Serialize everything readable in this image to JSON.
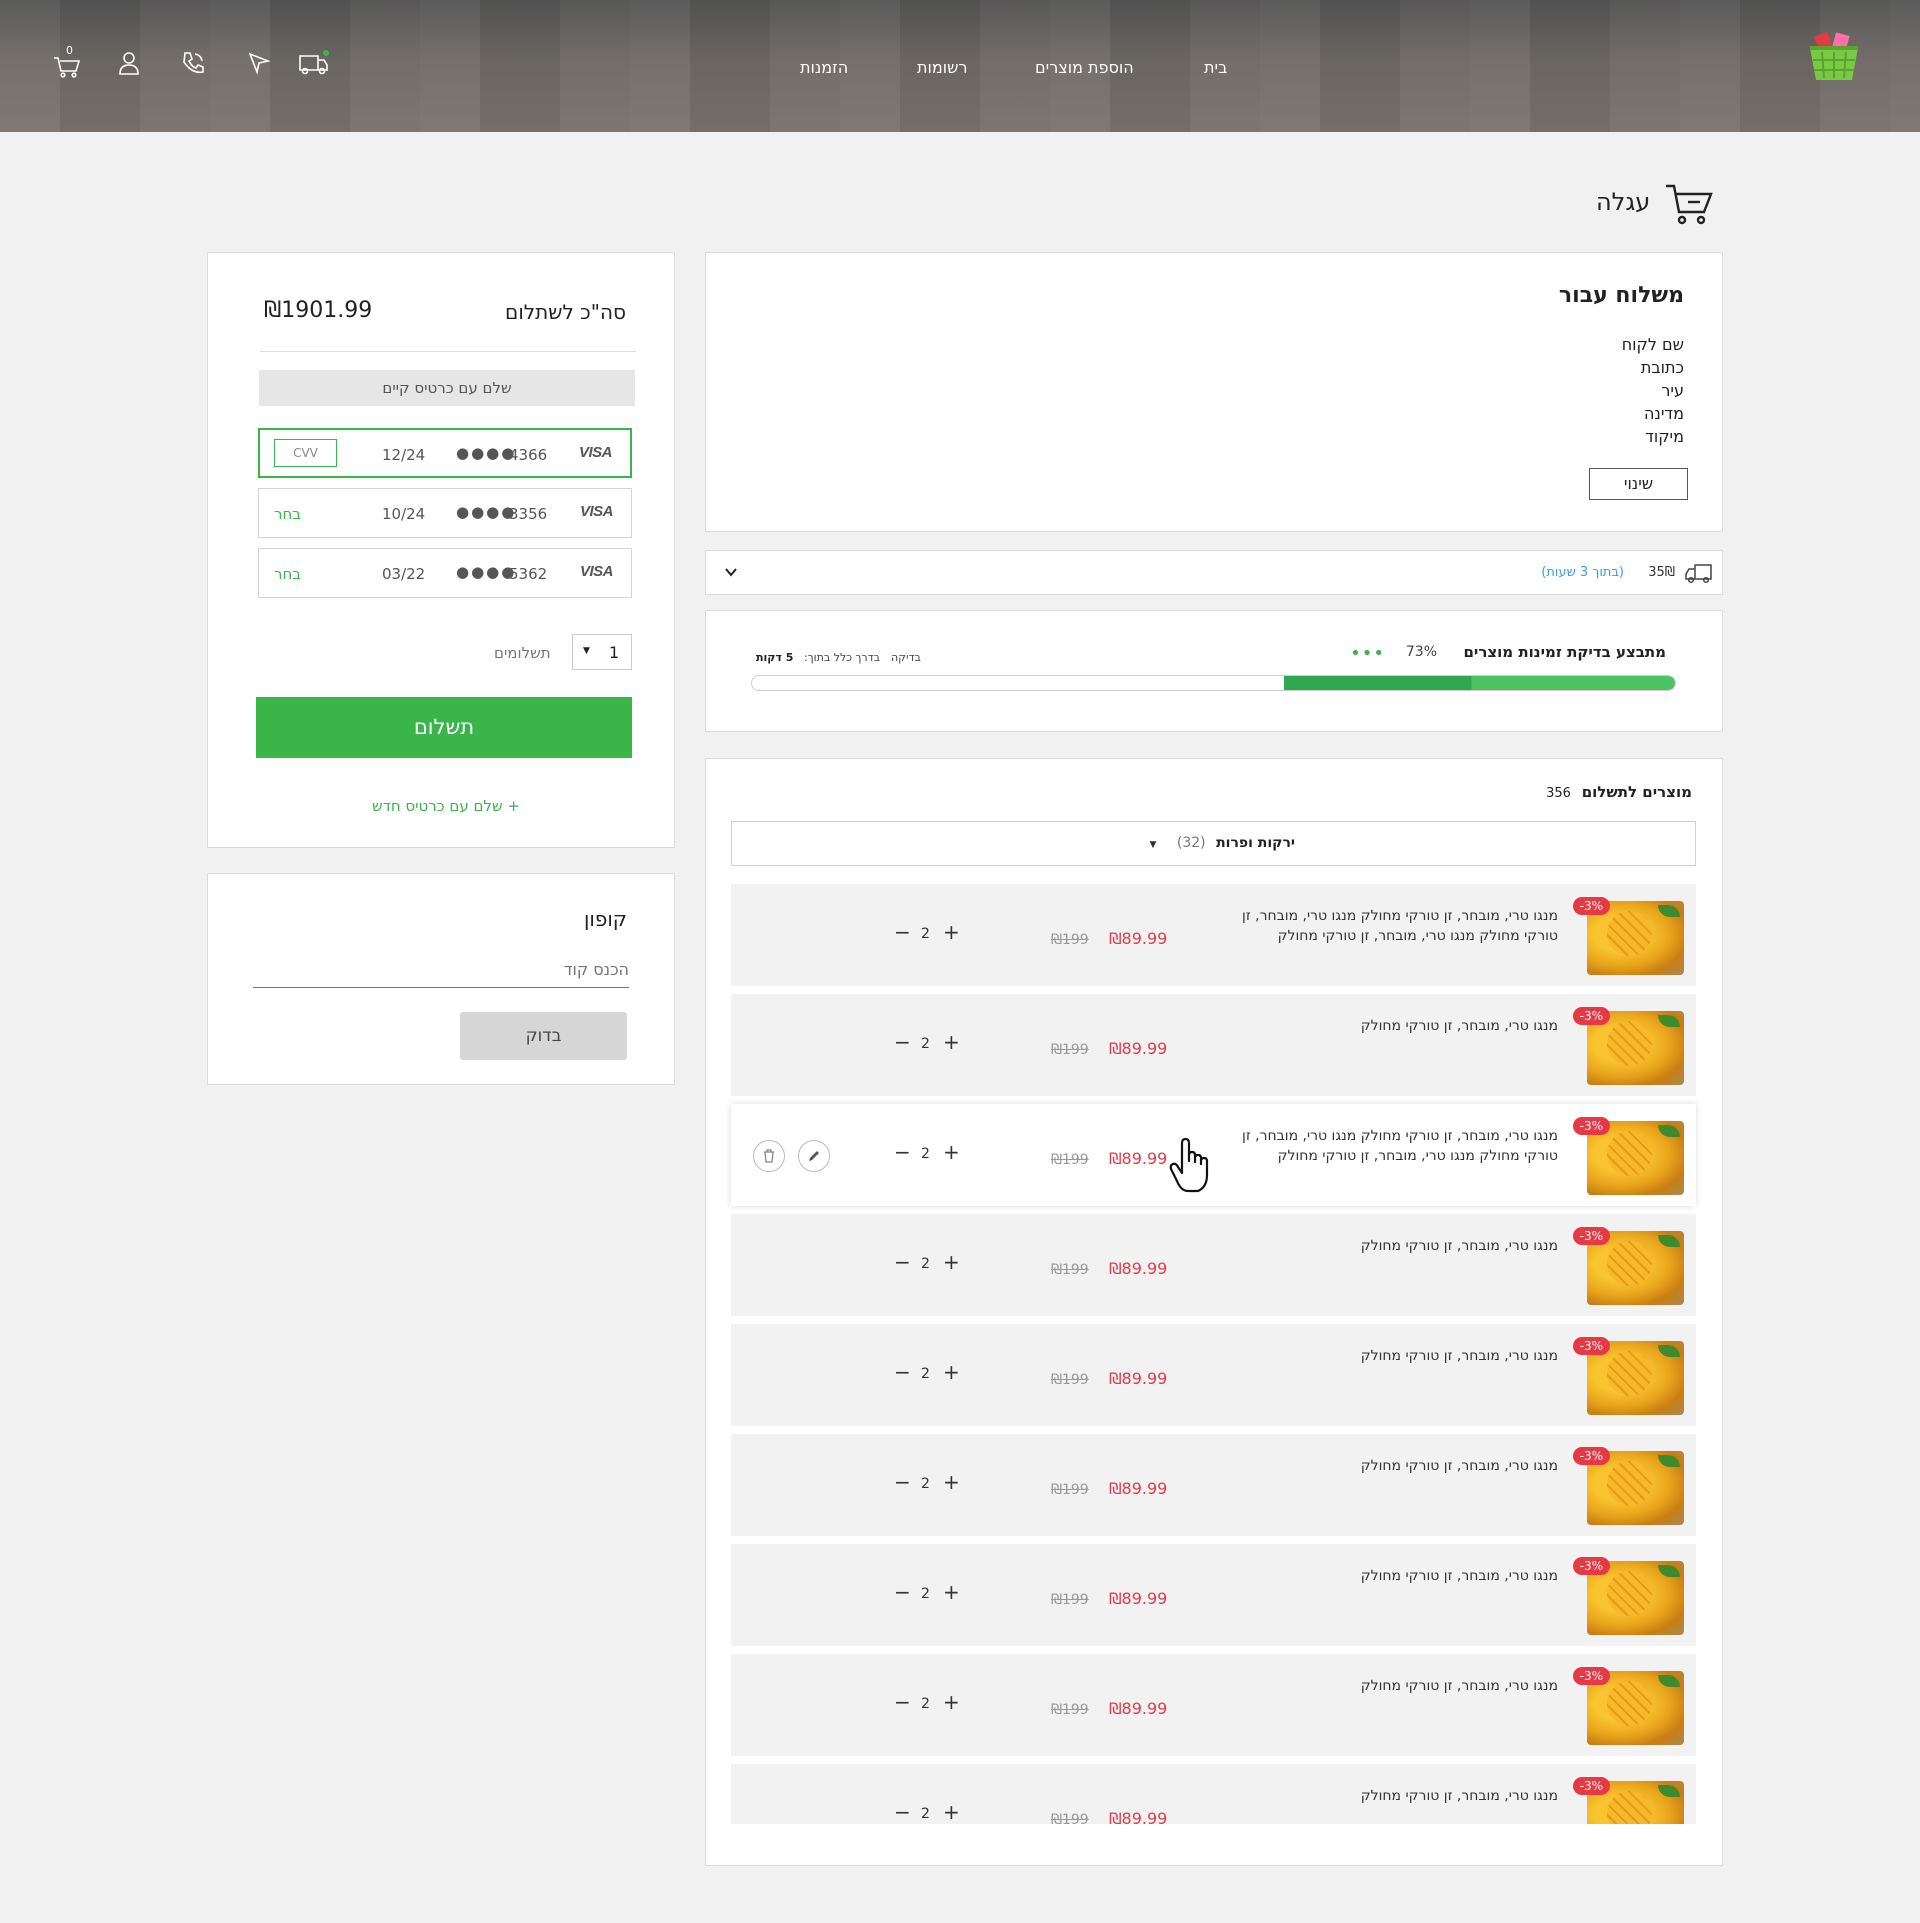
{
  "nav": {
    "logo": "basket-logo",
    "links": [
      "בית",
      "הוספת מוצרים",
      "רשומות",
      "הזמנות"
    ],
    "cart_count": "0"
  },
  "page": {
    "title": "עגלה"
  },
  "shipping": {
    "title": "משלוח עבור",
    "lines": [
      "שם לקוח",
      "כתובת",
      "עיר",
      "מדינה",
      "מיקוד"
    ],
    "change_button": "שינוי"
  },
  "delivery": {
    "price": "35₪",
    "eta": "(בתוך 3 שעות)"
  },
  "availability": {
    "title": "מתבצע בדיקת זמינות מוצרים",
    "percent": "73%",
    "progress": 0.73,
    "check_label": "בדיקה",
    "eta_label": "בדרך כלל בתוך:",
    "eta_value": "5 דקות"
  },
  "products": {
    "title": "מוצרים לתשלום",
    "count": "356",
    "category": "ירקות ופרות",
    "category_count": "(32)",
    "items": [
      {
        "name": "מנגו טרי, מובחר, זן טורקי מחולק מנגו טרי, מובחר, זן טורקי מחולק מנגו טרי, מובחר, זן טורקי מחולק",
        "price": "₪89.99",
        "old_price": "₪199",
        "qty": "2",
        "badge": "-3%"
      },
      {
        "name": "מנגו טרי, מובחר, זן טורקי מחולק",
        "price": "₪89.99",
        "old_price": "₪199",
        "qty": "2",
        "badge": "-3%"
      },
      {
        "name": "מנגו טרי, מובחר, זן טורקי מחולק מנגו טרי, מובחר, זן טורקי מחולק מנגו טרי, מובחר, זן טורקי מחולק",
        "price": "₪89.99",
        "old_price": "₪199",
        "qty": "2",
        "badge": "-3%"
      },
      {
        "name": "מנגו טרי, מובחר, זן טורקי מחולק",
        "price": "₪89.99",
        "old_price": "₪199",
        "qty": "2",
        "badge": "-3%"
      },
      {
        "name": "מנגו טרי, מובחר, זן טורקי מחולק",
        "price": "₪89.99",
        "old_price": "₪199",
        "qty": "2",
        "badge": "-3%"
      },
      {
        "name": "מנגו טרי, מובחר, זן טורקי מחולק",
        "price": "₪89.99",
        "old_price": "₪199",
        "qty": "2",
        "badge": "-3%"
      },
      {
        "name": "מנגו טרי, מובחר, זן טורקי מחולק",
        "price": "₪89.99",
        "old_price": "₪199",
        "qty": "2",
        "badge": "-3%"
      },
      {
        "name": "מנגו טרי, מובחר, זן טורקי מחולק",
        "price": "₪89.99",
        "old_price": "₪199",
        "qty": "2",
        "badge": "-3%"
      },
      {
        "name": "מנגו טרי, מובחר, זן טורקי מחולק",
        "price": "₪89.99",
        "old_price": "₪199",
        "qty": "2",
        "badge": "-3%"
      }
    ]
  },
  "payment": {
    "total_label": "סה\"כ לשתלום",
    "total": "₪1901.99",
    "existing_card_label": "שלם עם כרטיס קיים",
    "cards": [
      {
        "brand": "VISA",
        "last4": "4366",
        "exp": "12/24",
        "action": "CVV"
      },
      {
        "brand": "VISA",
        "last4": "3356",
        "exp": "10/24",
        "action": "בחר"
      },
      {
        "brand": "VISA",
        "last4": "5362",
        "exp": "03/22",
        "action": "בחר"
      }
    ],
    "installments_label": "תשלומים",
    "installments_value": "1",
    "pay_button": "תשלום",
    "new_card_link": "+ שלם עם כרטיס חדש"
  },
  "coupon": {
    "title": "קופון",
    "placeholder": "הכנס קוד",
    "check_button": "בדוק"
  },
  "colors": {
    "accent": "#3ab54a",
    "price": "#e63946",
    "link": "#3aa0e0"
  }
}
